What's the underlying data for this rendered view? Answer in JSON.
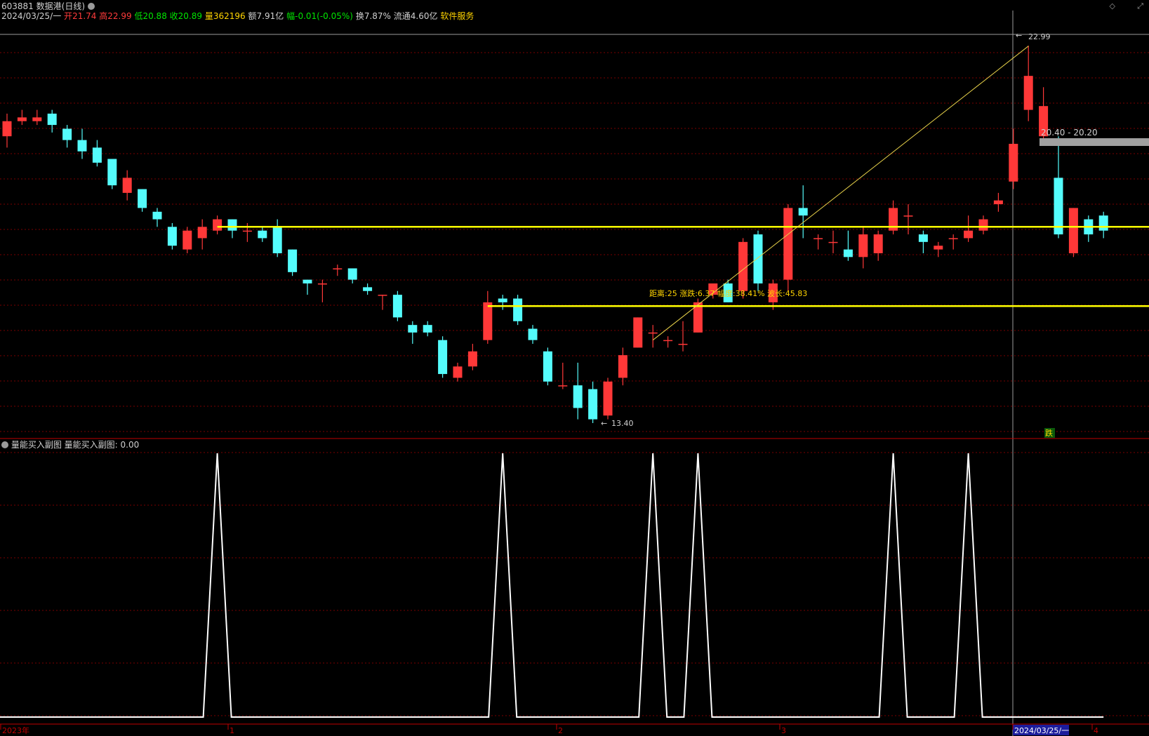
{
  "header": {
    "code": "603881",
    "name": "数据港(日线)",
    "date": "2024/03/25/一",
    "open_label": "开",
    "open": "21.74",
    "high_label": "高",
    "high": "22.99",
    "low_label": "低",
    "low": "20.88",
    "close_label": "收",
    "close": "20.89",
    "vol_label": "量",
    "vol": "362196",
    "amt_label": "额",
    "amt": "7.91亿",
    "chg_label": "幅",
    "chg": "-0.01(-0.05%)",
    "turn_label": "换",
    "turn": "7.87%",
    "float_label": "流通",
    "float": "4.60亿",
    "service": "软件服务"
  },
  "annotations": {
    "high_marker": "22.99",
    "low_marker": "13.40",
    "range_box": "20.40 - 20.20",
    "measure": "距离:25 涨跌:6.37 幅度:38.41% 波长:45.83",
    "signal": "跌"
  },
  "indicator": {
    "title": "量能买入副图",
    "value_text": "量能买入副图: 0.00"
  },
  "xaxis_labels": [
    "2023年",
    "1",
    "2",
    "3",
    "2024/03/25/一",
    "4"
  ],
  "colors": {
    "up": "#ff3838",
    "down": "#54fcfc",
    "grid": "#7a0000",
    "hline": "#ffff00",
    "trend": "#e8d24a",
    "axis_red": "#c00000"
  },
  "chart_data": [
    {
      "type": "candlestick",
      "ylim": [
        13.0,
        23.3
      ],
      "horizontal_lines": [
        18.2,
        16.1
      ],
      "candles": [
        [
          20.6,
          21.0,
          20.3,
          21.2
        ],
        [
          21.0,
          21.1,
          20.9,
          21.3
        ],
        [
          21.0,
          21.1,
          20.9,
          21.3
        ],
        [
          21.2,
          20.9,
          20.7,
          21.3
        ],
        [
          20.8,
          20.5,
          20.3,
          20.9
        ],
        [
          20.5,
          20.2,
          20.0,
          20.8
        ],
        [
          20.3,
          19.9,
          19.8,
          20.5
        ],
        [
          20.0,
          19.3,
          19.2,
          20.0
        ],
        [
          19.1,
          19.5,
          18.9,
          19.7
        ],
        [
          19.2,
          18.7,
          18.6,
          19.2
        ],
        [
          18.6,
          18.4,
          18.2,
          18.7
        ],
        [
          18.2,
          17.7,
          17.6,
          18.3
        ],
        [
          17.6,
          18.1,
          17.5,
          18.2
        ],
        [
          17.9,
          18.2,
          17.6,
          18.4
        ],
        [
          18.1,
          18.4,
          18.0,
          18.5
        ],
        [
          18.4,
          18.1,
          17.9,
          18.4
        ],
        [
          18.1,
          18.1,
          17.8,
          18.3
        ],
        [
          18.1,
          17.9,
          17.8,
          18.2
        ],
        [
          18.2,
          17.5,
          17.4,
          18.4
        ],
        [
          17.6,
          17.0,
          16.9,
          17.6
        ],
        [
          16.8,
          16.7,
          16.4,
          16.8
        ],
        [
          16.7,
          16.7,
          16.2,
          16.8
        ],
        [
          17.1,
          17.1,
          16.9,
          17.2
        ],
        [
          17.1,
          16.8,
          16.7,
          17.1
        ],
        [
          16.6,
          16.5,
          16.4,
          16.7
        ],
        [
          16.4,
          16.4,
          16.0,
          16.4
        ],
        [
          16.4,
          15.8,
          15.7,
          16.5
        ],
        [
          15.6,
          15.4,
          15.1,
          15.7
        ],
        [
          15.6,
          15.4,
          15.3,
          15.7
        ],
        [
          15.2,
          14.3,
          14.2,
          15.3
        ],
        [
          14.2,
          14.5,
          14.1,
          14.6
        ],
        [
          14.5,
          14.9,
          14.4,
          15.1
        ],
        [
          15.2,
          16.2,
          15.1,
          16.5
        ],
        [
          16.3,
          16.2,
          16.0,
          16.4
        ],
        [
          16.3,
          15.7,
          15.6,
          16.4
        ],
        [
          15.5,
          15.2,
          15.1,
          15.6
        ],
        [
          14.9,
          14.1,
          14.0,
          15.0
        ],
        [
          14.0,
          14.0,
          13.9,
          14.6
        ],
        [
          14.0,
          13.4,
          13.1,
          14.6
        ],
        [
          13.9,
          13.1,
          13.0,
          14.1
        ],
        [
          13.2,
          14.1,
          13.1,
          14.2
        ],
        [
          14.2,
          14.8,
          14.0,
          15.0
        ],
        [
          15.0,
          15.8,
          15.0,
          15.8
        ],
        [
          15.4,
          15.4,
          15.0,
          15.6
        ],
        [
          15.2,
          15.2,
          15.0,
          15.3
        ],
        [
          15.1,
          15.1,
          14.9,
          15.7
        ],
        [
          15.4,
          16.2,
          15.4,
          16.3
        ],
        [
          16.4,
          16.7,
          16.3,
          16.7
        ],
        [
          16.7,
          16.2,
          16.2,
          16.8
        ],
        [
          16.5,
          17.8,
          16.3,
          17.9
        ],
        [
          18.0,
          16.7,
          16.5,
          18.1
        ],
        [
          16.2,
          16.7,
          16.0,
          16.8
        ],
        [
          16.8,
          18.7,
          16.5,
          18.8
        ],
        [
          18.7,
          18.5,
          17.9,
          19.3
        ],
        [
          17.9,
          17.9,
          17.6,
          18.0
        ],
        [
          17.8,
          17.8,
          17.5,
          18.1
        ],
        [
          17.6,
          17.4,
          17.3,
          18.1
        ],
        [
          17.4,
          18.0,
          17.1,
          18.2
        ],
        [
          17.5,
          18.0,
          17.3,
          18.1
        ],
        [
          18.1,
          18.7,
          18.0,
          18.9
        ],
        [
          18.5,
          18.5,
          18.0,
          18.8
        ],
        [
          18.0,
          17.8,
          17.5,
          18.1
        ],
        [
          17.6,
          17.7,
          17.4,
          17.8
        ],
        [
          17.9,
          17.9,
          17.6,
          18.0
        ],
        [
          17.9,
          18.1,
          17.8,
          18.5
        ],
        [
          18.1,
          18.4,
          18.0,
          18.5
        ],
        [
          18.8,
          18.9,
          18.6,
          19.1
        ],
        [
          19.4,
          20.4,
          19.2,
          20.8
        ],
        [
          21.3,
          22.2,
          21.0,
          23.0
        ],
        [
          20.6,
          21.4,
          20.4,
          21.9
        ],
        [
          19.5,
          18.0,
          17.9,
          20.6
        ],
        [
          17.5,
          18.7,
          17.4,
          18.7
        ],
        [
          18.4,
          18.0,
          17.8,
          18.5
        ],
        [
          18.5,
          18.1,
          17.9,
          18.6
        ]
      ],
      "trend_line": {
        "from_index": 43,
        "from_price": 15.2,
        "to_index": 68,
        "to_price": 22.99
      }
    },
    {
      "type": "line",
      "name": "量能买入副图",
      "ylim": [
        0,
        1
      ],
      "spike_indices": [
        14,
        33,
        43,
        46,
        59,
        64
      ],
      "baseline_end_index": 73
    }
  ]
}
